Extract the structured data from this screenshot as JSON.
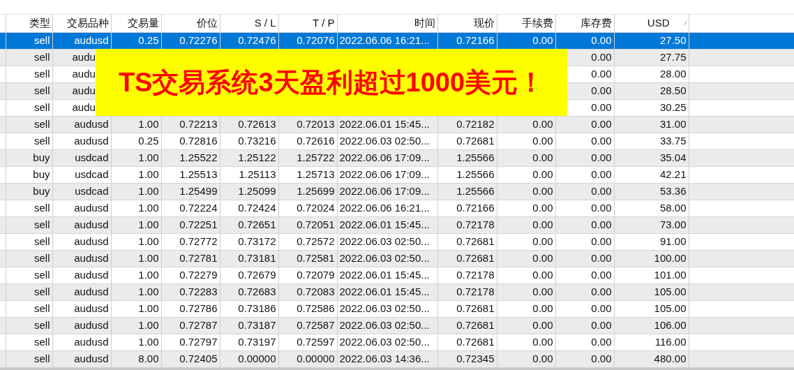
{
  "table": {
    "columns": [
      {
        "label": "类型",
        "sorted": false
      },
      {
        "label": "交易品种",
        "sorted": false
      },
      {
        "label": "交易量",
        "sorted": false
      },
      {
        "label": "价位",
        "sorted": false
      },
      {
        "label": "S / L",
        "sorted": false
      },
      {
        "label": "T / P",
        "sorted": false
      },
      {
        "label": "时间",
        "sorted": false
      },
      {
        "label": "现价",
        "sorted": false
      },
      {
        "label": "手续费",
        "sorted": false
      },
      {
        "label": "库存费",
        "sorted": false
      },
      {
        "label": "USD",
        "sorted": true
      }
    ],
    "rows": [
      {
        "selected": true,
        "cells": [
          "sell",
          "audusd",
          "0.25",
          "0.72276",
          "0.72476",
          "0.72076",
          "2022.06.06 16:21...",
          "0.72166",
          "0.00",
          "0.00",
          "27.50"
        ]
      },
      {
        "selected": false,
        "covered": true,
        "cells": [
          "sell",
          "audu",
          "",
          "",
          "",
          "",
          "",
          "",
          "",
          "0.00",
          "27.75"
        ]
      },
      {
        "selected": false,
        "covered": true,
        "cells": [
          "sell",
          "audu",
          "",
          "",
          "",
          "",
          "",
          "",
          "",
          "0.00",
          "28.00"
        ]
      },
      {
        "selected": false,
        "covered": true,
        "cells": [
          "sell",
          "audu",
          "",
          "",
          "",
          "",
          "",
          "",
          "",
          "0.00",
          "28.50"
        ]
      },
      {
        "selected": false,
        "covered": true,
        "cells": [
          "sell",
          "audu",
          "",
          "",
          "",
          "",
          "",
          "",
          "",
          "0.00",
          "30.25"
        ]
      },
      {
        "selected": false,
        "cells": [
          "sell",
          "audusd",
          "1.00",
          "0.72213",
          "0.72613",
          "0.72013",
          "2022.06.01 15:45...",
          "0.72182",
          "0.00",
          "0.00",
          "31.00"
        ]
      },
      {
        "selected": false,
        "cells": [
          "sell",
          "audusd",
          "0.25",
          "0.72816",
          "0.73216",
          "0.72616",
          "2022.06.03 02:50...",
          "0.72681",
          "0.00",
          "0.00",
          "33.75"
        ]
      },
      {
        "selected": false,
        "cells": [
          "buy",
          "usdcad",
          "1.00",
          "1.25522",
          "1.25122",
          "1.25722",
          "2022.06.06 17:09...",
          "1.25566",
          "0.00",
          "0.00",
          "35.04"
        ]
      },
      {
        "selected": false,
        "cells": [
          "buy",
          "usdcad",
          "1.00",
          "1.25513",
          "1.25113",
          "1.25713",
          "2022.06.06 17:09...",
          "1.25566",
          "0.00",
          "0.00",
          "42.21"
        ]
      },
      {
        "selected": false,
        "cells": [
          "buy",
          "usdcad",
          "1.00",
          "1.25499",
          "1.25099",
          "1.25699",
          "2022.06.06 17:09...",
          "1.25566",
          "0.00",
          "0.00",
          "53.36"
        ]
      },
      {
        "selected": false,
        "cells": [
          "sell",
          "audusd",
          "1.00",
          "0.72224",
          "0.72424",
          "0.72024",
          "2022.06.06 16:21...",
          "0.72166",
          "0.00",
          "0.00",
          "58.00"
        ]
      },
      {
        "selected": false,
        "cells": [
          "sell",
          "audusd",
          "1.00",
          "0.72251",
          "0.72651",
          "0.72051",
          "2022.06.01 15:45...",
          "0.72178",
          "0.00",
          "0.00",
          "73.00"
        ]
      },
      {
        "selected": false,
        "cells": [
          "sell",
          "audusd",
          "1.00",
          "0.72772",
          "0.73172",
          "0.72572",
          "2022.06.03 02:50...",
          "0.72681",
          "0.00",
          "0.00",
          "91.00"
        ]
      },
      {
        "selected": false,
        "cells": [
          "sell",
          "audusd",
          "1.00",
          "0.72781",
          "0.73181",
          "0.72581",
          "2022.06.03 02:50...",
          "0.72681",
          "0.00",
          "0.00",
          "100.00"
        ]
      },
      {
        "selected": false,
        "cells": [
          "sell",
          "audusd",
          "1.00",
          "0.72279",
          "0.72679",
          "0.72079",
          "2022.06.01 15:45...",
          "0.72178",
          "0.00",
          "0.00",
          "101.00"
        ]
      },
      {
        "selected": false,
        "cells": [
          "sell",
          "audusd",
          "1.00",
          "0.72283",
          "0.72683",
          "0.72083",
          "2022.06.01 15:45...",
          "0.72178",
          "0.00",
          "0.00",
          "105.00"
        ]
      },
      {
        "selected": false,
        "cells": [
          "sell",
          "audusd",
          "1.00",
          "0.72786",
          "0.73186",
          "0.72586",
          "2022.06.03 02:50...",
          "0.72681",
          "0.00",
          "0.00",
          "105.00"
        ]
      },
      {
        "selected": false,
        "cells": [
          "sell",
          "audusd",
          "1.00",
          "0.72787",
          "0.73187",
          "0.72587",
          "2022.06.03 02:50...",
          "0.72681",
          "0.00",
          "0.00",
          "106.00"
        ]
      },
      {
        "selected": false,
        "cells": [
          "sell",
          "audusd",
          "1.00",
          "0.72797",
          "0.73197",
          "0.72597",
          "2022.06.03 02:50...",
          "0.72681",
          "0.00",
          "0.00",
          "116.00"
        ]
      },
      {
        "selected": false,
        "cells": [
          "sell",
          "audusd",
          "8.00",
          "0.72405",
          "0.00000",
          "0.00000",
          "2022.06.03 14:36...",
          "0.72345",
          "0.00",
          "0.00",
          "480.00"
        ]
      }
    ]
  },
  "banner": {
    "text": "TS交易系统3天盈利超过1000美元！"
  }
}
